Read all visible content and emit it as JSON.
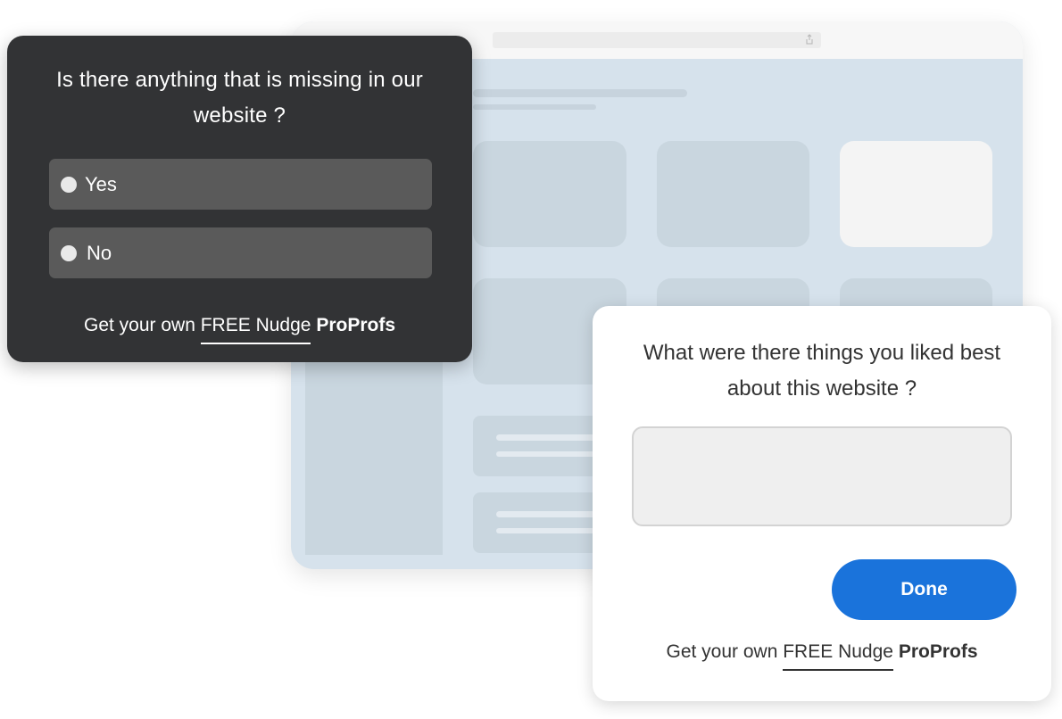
{
  "colors": {
    "dark_popup_bg": "#323335",
    "option_bg": "#5a5a5a",
    "accent_button": "#1a73db",
    "browser_bg": "#d6e2ec"
  },
  "icons": {
    "radio": "radio-circle-icon",
    "share": "share-icon"
  },
  "dark_survey": {
    "question": "Is there anything that is missing in our website ?",
    "options": [
      {
        "label": "Yes"
      },
      {
        "label": "No"
      }
    ],
    "footer": {
      "prefix": "Get your own ",
      "link": "FREE Nudge",
      "brand": "ProProfs"
    }
  },
  "feedback_survey": {
    "question": "What were there things you liked best about this website ?",
    "answer_value": "",
    "button_label": "Done",
    "footer": {
      "prefix": "Get your own ",
      "link": "FREE Nudge",
      "brand": "ProProfs"
    }
  }
}
